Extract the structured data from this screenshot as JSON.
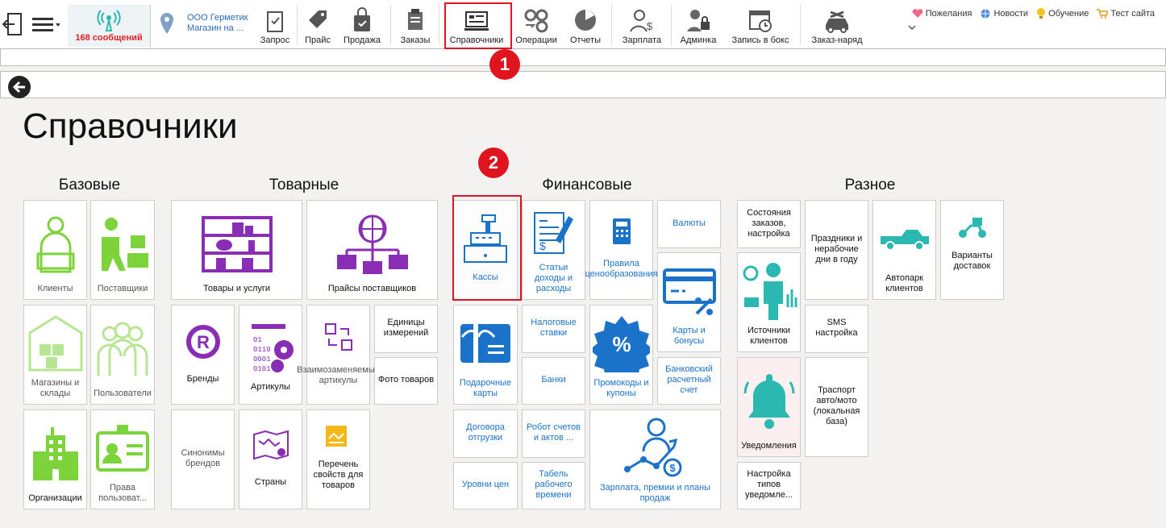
{
  "toolbar": {
    "messages": "168 сообщений",
    "store_line1": "ООО Герметик",
    "store_line2": "Магазин на ...",
    "buttons": [
      "Запрос",
      "Прайс",
      "Продажа",
      "Заказы",
      "Справочники",
      "Операции",
      "Отчеты",
      "Зарплата",
      "Админка",
      "Запись в бокс",
      "Заказ-наряд"
    ],
    "links": [
      "Пожелания",
      "Новости",
      "Обучение",
      "Тест сайта"
    ]
  },
  "page": {
    "title": "Справочники"
  },
  "sections": {
    "basic": "Базовые",
    "goods": "Товарные",
    "finance": "Финансовые",
    "misc": "Разное"
  },
  "tiles": {
    "clients": "Клиенты",
    "suppliers": "Поставщики",
    "stores": "Магазины и склады",
    "users": "Пользователи",
    "orgs": "Организации",
    "rights": "Права пользоват...",
    "goods": "Товары и услуги",
    "supplier_prices": "Прайсы поставщиков",
    "brands": "Бренды",
    "articles": "Артикулы",
    "interchange": "Взаимозаменяемые артикулы",
    "units": "Единицы измерений",
    "photo": "Фото товаров",
    "brand_synonyms": "Синонимы брендов",
    "countries": "Страны",
    "properties": "Перечень свойств для товаров",
    "cash": "Кассы",
    "income_expense": "Статьи доходы и расходы",
    "pricing_rules": "Правила ценообразования",
    "currencies": "Валюты",
    "cards_bonuses": "Карты и бонусы",
    "gift_cards": "Подарочные карты",
    "tax_rates": "Налоговые ставки",
    "promo": "Промокоды и купоны",
    "banks": "Банки",
    "bank_account": "Банковский расчетный счет",
    "delivery_contracts": "Договора отгрузки",
    "robot": "Робот счетов и актов ...",
    "salary_plans": "Зарплата, премии и планы продаж",
    "price_levels": "Уровни цен",
    "timesheet": "Табель рабочего времени",
    "order_states": "Состояния заказов, настройка",
    "holidays": "Праздники и нерабочие дни в году",
    "fleet": "Автопарк клиентов",
    "delivery_options": "Варианты доставок",
    "client_sources": "Источники клиентов",
    "sms": "SMS настройка",
    "notifications": "Уведомления",
    "transport": "Траспорт авто/мото (локальная база)",
    "notif_types": "Настройка типов уведомле..."
  },
  "badges": [
    "1",
    "2"
  ],
  "colors": {
    "accent_red": "#e0141e",
    "green": "#7dd33a",
    "purple": "#8a2db5",
    "blue": "#1a73c8",
    "teal": "#2ab8b0"
  }
}
